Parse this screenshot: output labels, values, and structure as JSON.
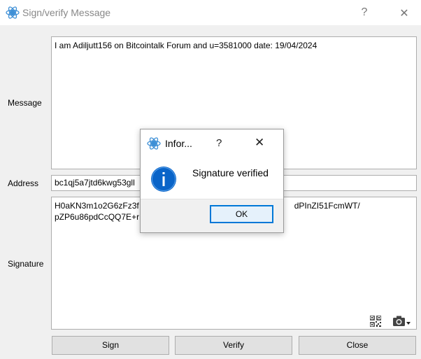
{
  "window": {
    "title": "Sign/verify Message",
    "help_label": "?",
    "close_label": "✕"
  },
  "form": {
    "message_label": "Message",
    "message_value": "I am Adiljutt156 on Bitcointalk Forum and u=3581000 date: 19/04/2024",
    "address_label": "Address",
    "address_value": "bc1qj5a7jtd6kwg53gll",
    "signature_label": "Signature",
    "signature_line1": "H0aKN3m1o2G6zFz3f",
    "signature_line1_tail": "dPInZI51FcmWT/",
    "signature_line2": "pZP6u86pdCcQQ7E+r"
  },
  "buttons": {
    "sign": "Sign",
    "verify": "Verify",
    "close": "Close"
  },
  "dialog": {
    "title": "Infor...",
    "help_label": "?",
    "close_label": "✕",
    "message": "Signature verified",
    "ok_label": "OK"
  },
  "colors": {
    "accent": "#0078d7",
    "info_icon": "#0a64c8",
    "app_icon": "#3d8fd6"
  },
  "icons": {
    "app": "electrum-logo-icon",
    "qr": "qr-code-icon",
    "camera": "camera-icon",
    "info": "info-icon"
  }
}
